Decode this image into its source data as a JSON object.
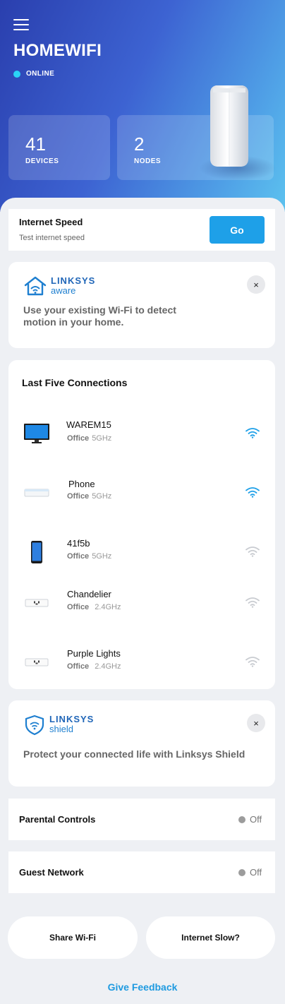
{
  "header": {
    "network_name": "HOMEWIFI",
    "status": "ONLINE",
    "status_color": "#2ad4f6",
    "devices": {
      "count": "41",
      "label": "DEVICES"
    },
    "nodes": {
      "count": "2",
      "label": "NODES"
    }
  },
  "speed": {
    "title": "Internet Speed",
    "subtitle": "Test internet speed",
    "button": "Go"
  },
  "aware": {
    "brand": "LINKSYS",
    "brand_sub": "aware",
    "text": "Use your existing Wi-Fi to detect motion in your home.",
    "close_icon": "×"
  },
  "connections": {
    "title": "Last Five Connections",
    "items": [
      {
        "name": "WAREM15",
        "location": "Office",
        "band": "5GHz",
        "device_icon": "monitor-icon",
        "signal": "strong"
      },
      {
        "name": "Phone",
        "location": "Office",
        "band": "5GHz",
        "device_icon": "tv-box-icon",
        "signal": "strong"
      },
      {
        "name": "41f5b",
        "location": "Office",
        "band": "5GHz",
        "device_icon": "smartphone-icon",
        "signal": "weak"
      },
      {
        "name": "Chandelier",
        "location": "Office",
        "band": "2.4GHz",
        "device_icon": "smart-plug-icon",
        "signal": "weak"
      },
      {
        "name": "Purple Lights",
        "location": "Office",
        "band": "2.4GHz",
        "device_icon": "smart-plug-icon",
        "signal": "weak"
      }
    ]
  },
  "shield": {
    "brand": "LINKSYS",
    "brand_sub": "shield",
    "text": "Protect your connected life with Linksys Shield",
    "close_icon": "×"
  },
  "parental_controls": {
    "label": "Parental Controls",
    "state": "Off"
  },
  "guest_network": {
    "label": "Guest Network",
    "state": "Off"
  },
  "actions": {
    "share_wifi": "Share Wi-Fi",
    "internet_slow": "Internet Slow?"
  },
  "feedback": "Give Feedback",
  "colors": {
    "accent": "#1ea0e8",
    "wifi_strong": "#1ea0e8",
    "wifi_weak": "#c9ccd1"
  }
}
